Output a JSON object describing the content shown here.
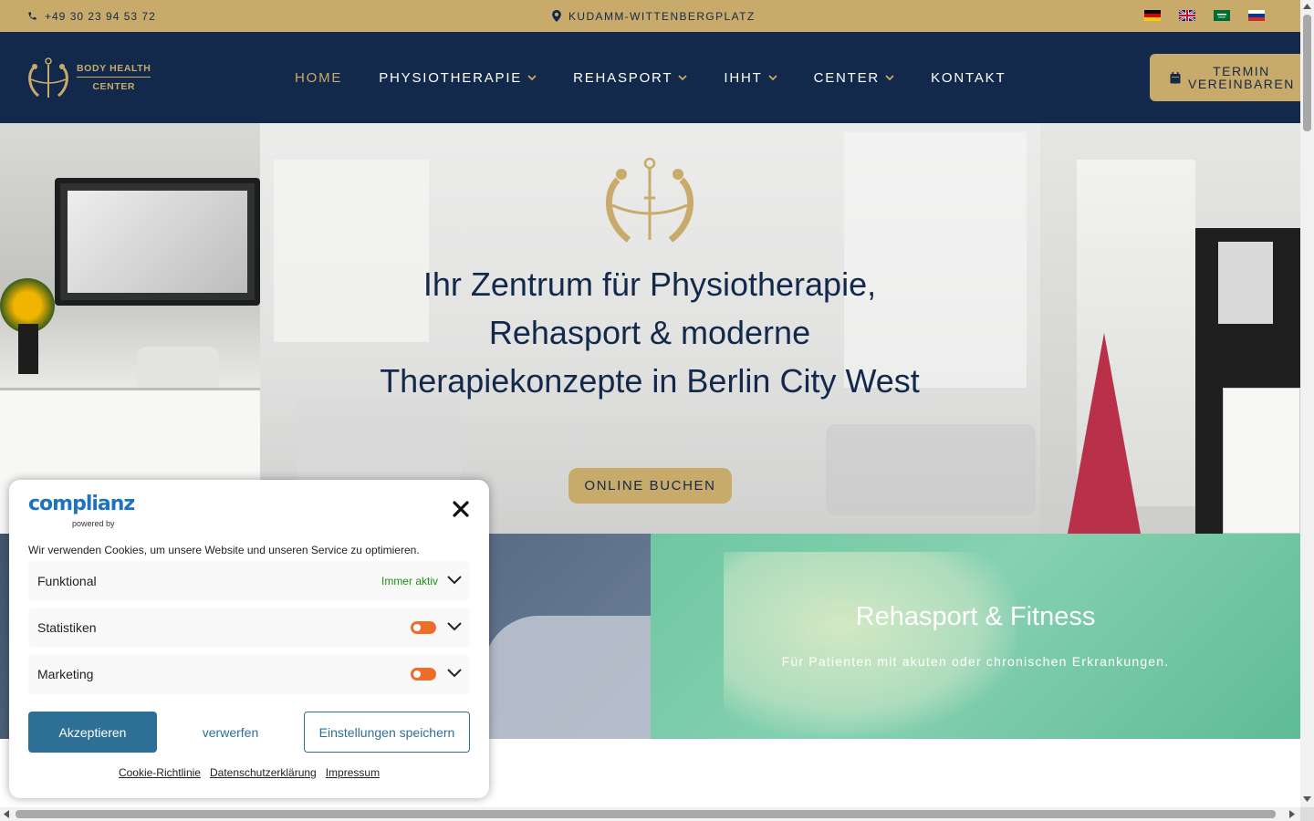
{
  "topbar": {
    "phone": "+49 30 23 94 53 72",
    "location": "KUDAMM-WITTENBERGPLATZ",
    "languages": [
      "de-flag-icon",
      "gb-flag-icon",
      "sa-flag-icon",
      "ru-flag-icon"
    ]
  },
  "header": {
    "logo_line1": "BODY HEALTH",
    "logo_line2": "CENTER",
    "nav": [
      {
        "label": "HOME",
        "active": true
      },
      {
        "label": "PHYSIOTHERAPIE",
        "dropdown": true
      },
      {
        "label": "REHASPORT",
        "dropdown": true
      },
      {
        "label": "IHHT",
        "dropdown": true
      },
      {
        "label": "CENTER",
        "dropdown": true
      },
      {
        "label": "KONTAKT"
      }
    ],
    "cta_line1": "TERMIN",
    "cta_line2": "VEREINBAREN"
  },
  "hero": {
    "title": "Ihr Zentrum für Physiotherapie, Rehasport & moderne Therapiekonzepte in Berlin City West",
    "button": "ONLINE BUCHEN"
  },
  "tiles": {
    "right_title": "Rehasport & Fitness",
    "right_subtitle": "Für Patienten mit akuten oder chronischen Erkrankungen."
  },
  "cookie": {
    "brand": "complianz",
    "powered_by": "powered by",
    "message": "Wir verwenden Cookies, um unsere Website und unseren Service zu optimieren.",
    "categories": [
      {
        "name": "Funktional",
        "status": "Immer aktiv"
      },
      {
        "name": "Statistiken"
      },
      {
        "name": "Marketing"
      }
    ],
    "accept": "Akzeptieren",
    "deny": "verwerfen",
    "save": "Einstellungen speichern",
    "links": [
      "Cookie-Richtlinie",
      "Datenschutzerklärung",
      "Impressum"
    ]
  },
  "colors": {
    "gold": "#c8ab6a",
    "navy": "#13294b",
    "accept_blue": "#2e6f95",
    "toggle_orange": "#ef6c2b"
  }
}
